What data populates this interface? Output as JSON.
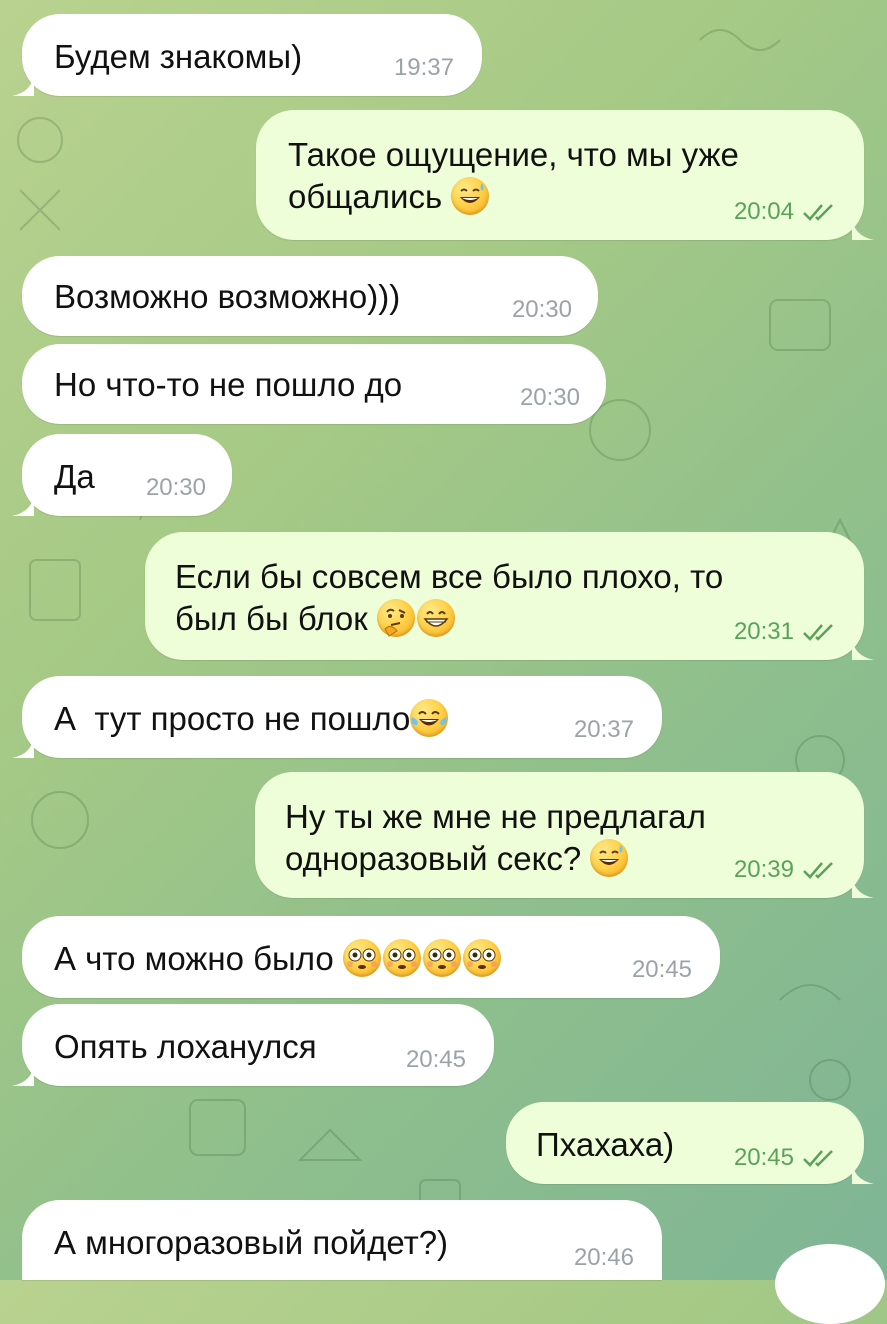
{
  "messages": [
    {
      "id": "m1",
      "dir": "in",
      "text": "Будем знакомы)",
      "emojis": [],
      "time": "19:37",
      "read": false
    },
    {
      "id": "m2",
      "dir": "out",
      "text": "Такое ощущение, что мы уже\nобщались ",
      "emojis": [
        "grinning-sweat-emoji"
      ],
      "time": "20:04",
      "read": true
    },
    {
      "id": "m3",
      "dir": "in",
      "text": "Возможно возможно)))",
      "emojis": [],
      "time": "20:30",
      "read": false
    },
    {
      "id": "m4",
      "dir": "in",
      "text": "Но что-то не пошло до",
      "emojis": [],
      "time": "20:30",
      "read": false
    },
    {
      "id": "m5",
      "dir": "in",
      "text": "Да",
      "emojis": [],
      "time": "20:30",
      "read": false
    },
    {
      "id": "m6",
      "dir": "out",
      "text": "Если бы совсем все было плохо, то\nбыл бы блок ",
      "emojis": [
        "thinking-emoji",
        "grin-emoji"
      ],
      "time": "20:31",
      "read": true
    },
    {
      "id": "m7",
      "dir": "in",
      "text": "А  тут просто не пошло",
      "emojis": [
        "tears-of-joy-emoji"
      ],
      "time": "20:37",
      "read": false
    },
    {
      "id": "m8",
      "dir": "out",
      "text": "Ну ты же мне не предлагал\nодноразовый секс? ",
      "emojis": [
        "grinning-sweat-emoji"
      ],
      "time": "20:39",
      "read": true
    },
    {
      "id": "m9",
      "dir": "in",
      "text": "А что можно было ",
      "emojis": [
        "flushed-emoji",
        "flushed-emoji",
        "flushed-emoji",
        "flushed-emoji"
      ],
      "time": "20:45",
      "read": false
    },
    {
      "id": "m10",
      "dir": "in",
      "text": "Опять лоханулся",
      "emojis": [],
      "time": "20:45",
      "read": false
    },
    {
      "id": "m11",
      "dir": "out",
      "text": "Пхахаха)",
      "emojis": [],
      "time": "20:45",
      "read": true
    },
    {
      "id": "m12",
      "dir": "in",
      "text": "А многоразовый пойдет?)",
      "emojis": [],
      "time": "20:46",
      "read": false
    }
  ],
  "colors": {
    "incoming": "#ffffff",
    "outgoing": "#eefed9",
    "read_ticks": "#5aa25a",
    "time_in": "#9aa3a8"
  }
}
